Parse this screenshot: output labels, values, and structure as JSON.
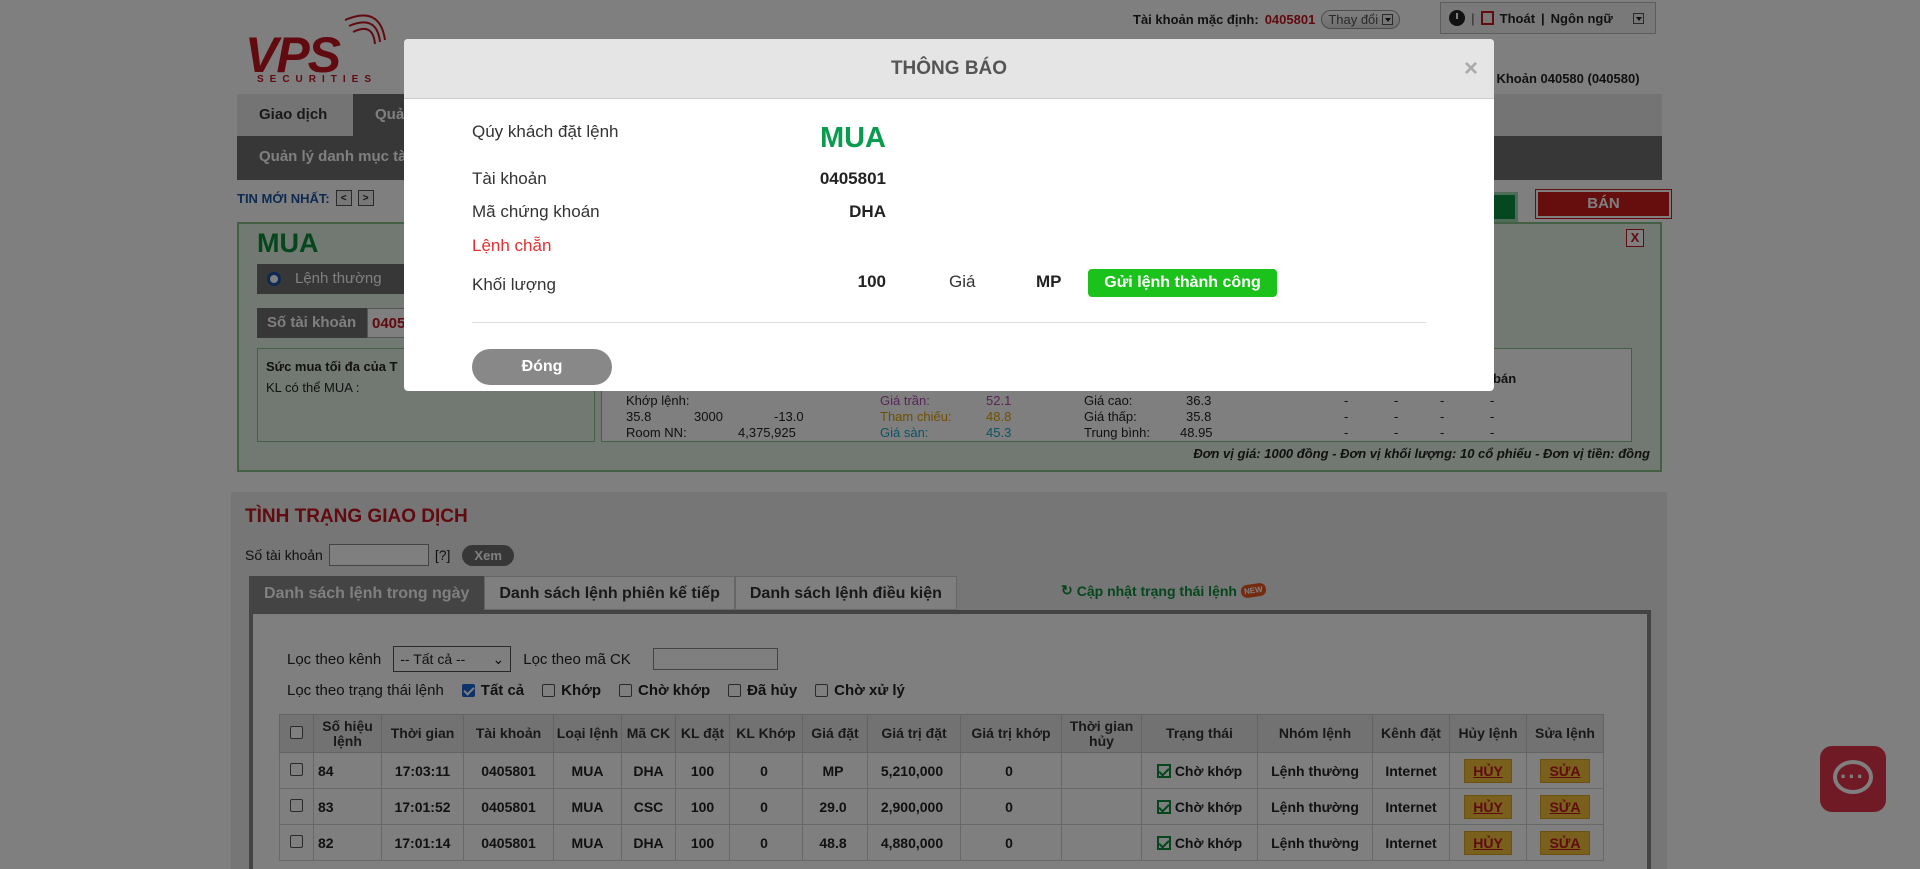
{
  "logo": {
    "main": "VPS",
    "sub": "SECURITIES"
  },
  "header": {
    "default_account_label": "Tài khoản mặc định:",
    "default_account": "0405801",
    "change_label": "Thay đổi",
    "logout_label": "Thoát",
    "language_label": "Ngôn ngữ",
    "account_line": "ài Khoản 040580 (040580)"
  },
  "nav": {
    "tabs": [
      "Giao dịch",
      "Quản"
    ],
    "sub_label": "Quản lý danh mục tà"
  },
  "news": {
    "label": "TIN MỚI NHẤT:",
    "prev": "<",
    "next": ">"
  },
  "trade_buttons": {
    "sell": "BÁN"
  },
  "order_panel": {
    "title": "MUA",
    "close": "X",
    "order_type": "Lệnh thường",
    "account_label": "Số tài khoản",
    "account_value": "0405",
    "power_title": "Sức mua tối đa của T",
    "power_qty": "KL có thể MUA :",
    "quote": {
      "match_label": "Khớp lệnh:",
      "match_price": "35.8",
      "match_qty": "3000",
      "match_change": "-13.0",
      "room_label": "Room NN:",
      "room_value": "4,375,925",
      "ceiling_label": "Giá trần:",
      "ceiling_value": "52.1",
      "ref_label": "Tham chiếu:",
      "ref_value": "48.8",
      "floor_label": "Giá sàn:",
      "floor_value": "45.3",
      "high_label": "Giá cao:",
      "high_value": "36.3",
      "low_label": "Giá thấp:",
      "low_value": "35.8",
      "avg_label": "Trung bình:",
      "avg_value": "48.95",
      "sell_label": "ư bán",
      "dash": "-"
    },
    "unit_note": "Đơn vị giá: 1000 đồng - Đơn vị khối lượng: 10 cổ phiếu - Đơn vị tiền: đồng"
  },
  "status": {
    "title": "TÌNH TRẠNG GIAO DỊCH",
    "account_label": "Số tài khoản",
    "help": "[?]",
    "view_button": "Xem",
    "tabs": [
      "Danh sách lệnh trong ngày",
      "Danh sách lệnh phiên kế tiếp",
      "Danh sách lệnh điều kiện"
    ],
    "refresh_label": "Cập nhật trạng thái lệnh",
    "new_badge": "NEW",
    "filter_channel_label": "Lọc theo kênh",
    "filter_channel_value": "-- Tất cả --",
    "filter_code_label": "Lọc theo mã CK",
    "filter_status_label": "Lọc theo trạng thái lệnh",
    "status_options": [
      "Tất cả",
      "Khớp",
      "Chờ khớp",
      "Đã hủy",
      "Chờ xử lý"
    ],
    "columns": [
      "Số hiệu lệnh",
      "Thời gian",
      "Tài khoản",
      "Loại lệnh",
      "Mã CK",
      "KL đặt",
      "KL Khớp",
      "Giá đặt",
      "Giá trị đặt",
      "Giá trị khớp",
      "Thời gian hủy",
      "Trạng thái",
      "Nhóm lệnh",
      "Kênh đặt",
      "Hủy lệnh",
      "Sửa lệnh"
    ],
    "rows": [
      {
        "id": "84",
        "time": "17:03:11",
        "account": "0405801",
        "type": "MUA",
        "code": "DHA",
        "qty": "100",
        "matched": "0",
        "price": "MP",
        "value": "5,210,000",
        "matched_value": "0",
        "cancel_time": "",
        "state": "Chờ khớp",
        "group": "Lệnh thường",
        "channel": "Internet",
        "cancel": "HỦY",
        "edit": "SỬA"
      },
      {
        "id": "83",
        "time": "17:01:52",
        "account": "0405801",
        "type": "MUA",
        "code": "CSC",
        "qty": "100",
        "matched": "0",
        "price": "29.0",
        "value": "2,900,000",
        "matched_value": "0",
        "cancel_time": "",
        "state": "Chờ khớp",
        "group": "Lệnh thường",
        "channel": "Internet",
        "cancel": "HỦY",
        "edit": "SỬA"
      },
      {
        "id": "82",
        "time": "17:01:14",
        "account": "0405801",
        "type": "MUA",
        "code": "DHA",
        "qty": "100",
        "matched": "0",
        "price": "48.8",
        "value": "4,880,000",
        "matched_value": "0",
        "cancel_time": "",
        "state": "Chờ khớp",
        "group": "Lệnh thường",
        "channel": "Internet",
        "cancel": "HỦY",
        "edit": "SỬA"
      }
    ]
  },
  "modal": {
    "title": "THÔNG BÁO",
    "close": "×",
    "order_label": "Qúy khách đặt lệnh",
    "side": "MUA",
    "account_label": "Tài khoản",
    "account": "0405801",
    "code_label": "Mã chứng khoán",
    "code": "DHA",
    "lot_label": "Lệnh chẵn",
    "qty_label": "Khối lượng",
    "qty": "100",
    "price_label": "Giá",
    "price": "MP",
    "success": "Gửi lệnh thành công",
    "close_button": "Đóng"
  },
  "colors": {
    "brand": "#c2151f",
    "buy": "#0a9c4e",
    "success": "#1cc21c",
    "panel_bg": "#e4f3e4"
  }
}
